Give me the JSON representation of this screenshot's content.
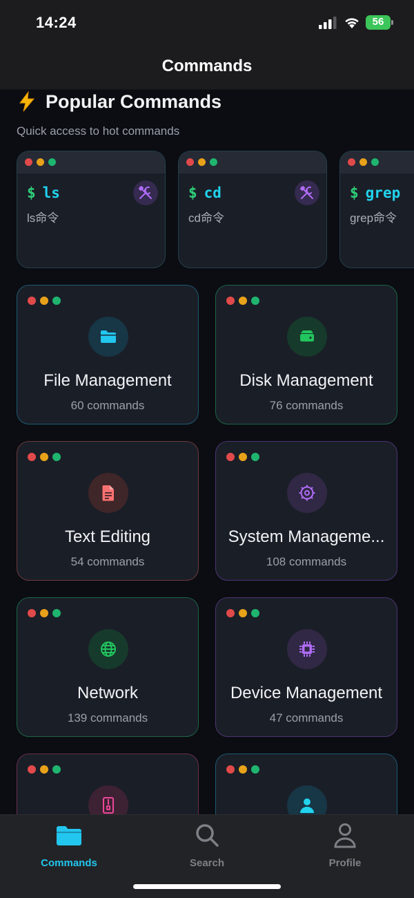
{
  "status_bar": {
    "time": "14:24",
    "battery": "56",
    "icons": [
      "signal-icon",
      "wifi-icon",
      "battery-icon"
    ]
  },
  "nav": {
    "title": "Commands"
  },
  "popular": {
    "title": "Popular Commands",
    "subtitle": "Quick access to hot commands",
    "commands": [
      {
        "prompt": "$",
        "name": "ls",
        "description": "ls命令",
        "icon": "tools-icon"
      },
      {
        "prompt": "$",
        "name": "cd",
        "description": "cd命令",
        "icon": "tools-icon"
      },
      {
        "prompt": "$",
        "name": "grep",
        "description": "grep命令",
        "icon": "tools-icon"
      }
    ]
  },
  "categories": [
    {
      "title": "File Management",
      "count": "60 commands",
      "icon": "folder-icon",
      "accent": "#2ea7d6"
    },
    {
      "title": "Disk Management",
      "count": "76 commands",
      "icon": "hard-drive-icon",
      "accent": "#22c55e"
    },
    {
      "title": "Text Editing",
      "count": "54 commands",
      "icon": "document-icon",
      "accent": "#f87171"
    },
    {
      "title": "System Manageme...",
      "count": "108 commands",
      "icon": "settings-gear-icon",
      "accent": "#a855f7"
    },
    {
      "title": "Network",
      "count": "139 commands",
      "icon": "globe-icon",
      "accent": "#22c55e"
    },
    {
      "title": "Device Management",
      "count": "47 commands",
      "icon": "chip-icon",
      "accent": "#a855f7"
    },
    {
      "title": "",
      "count": "",
      "icon": "archive-icon",
      "accent": "#ec4899"
    },
    {
      "title": "",
      "count": "",
      "icon": "user-icon",
      "accent": "#22d3ee"
    }
  ],
  "tabs": [
    {
      "label": "Commands",
      "icon": "folder-icon",
      "active": true
    },
    {
      "label": "Search",
      "icon": "search-icon",
      "active": false
    },
    {
      "label": "Profile",
      "icon": "profile-icon",
      "active": false
    }
  ],
  "colors": {
    "accent": "#22c6ee",
    "background": "#0b0d12",
    "card": "#1a1e27",
    "prompt_green": "#2fd07a"
  }
}
